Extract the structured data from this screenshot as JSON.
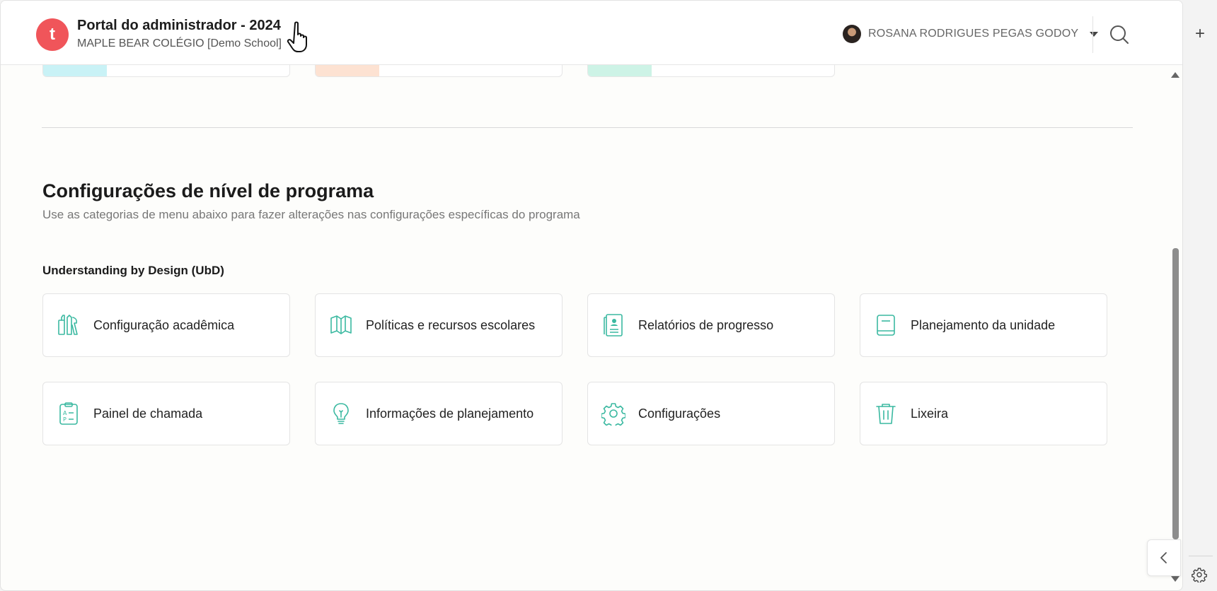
{
  "header": {
    "logo_letter": "t",
    "title": "Portal do administrador - 2024",
    "school": "MAPLE BEAR COLÉGIO [Demo School]",
    "user_name": "ROSANA RODRIGUES PEGAS GODOY"
  },
  "section": {
    "title": "Configurações de nível de programa",
    "subtitle": "Use as categorias de menu abaixo para fazer alterações nas configurações específicas do programa",
    "group_title": "Understanding by Design (UbD)"
  },
  "cards": [
    {
      "label": "Configuração acadêmica",
      "icon": "tools-icon"
    },
    {
      "label": "Políticas e recursos escolares",
      "icon": "book-open-icon"
    },
    {
      "label": "Relatórios de progresso",
      "icon": "report-icon"
    },
    {
      "label": "Planejamento da unidade",
      "icon": "notebook-icon"
    },
    {
      "label": "Painel de chamada",
      "icon": "clipboard-icon"
    },
    {
      "label": "Informações de planejamento",
      "icon": "lightbulb-icon"
    },
    {
      "label": "Configurações",
      "icon": "gear-icon"
    },
    {
      "label": "Lixeira",
      "icon": "trash-icon"
    }
  ],
  "colors": {
    "brand": "#f0555a",
    "icon_accent": "#3bb9a1",
    "partial_card_stripes": [
      "#c9f2f6",
      "#fde2d2",
      "#cdf3e6"
    ]
  }
}
